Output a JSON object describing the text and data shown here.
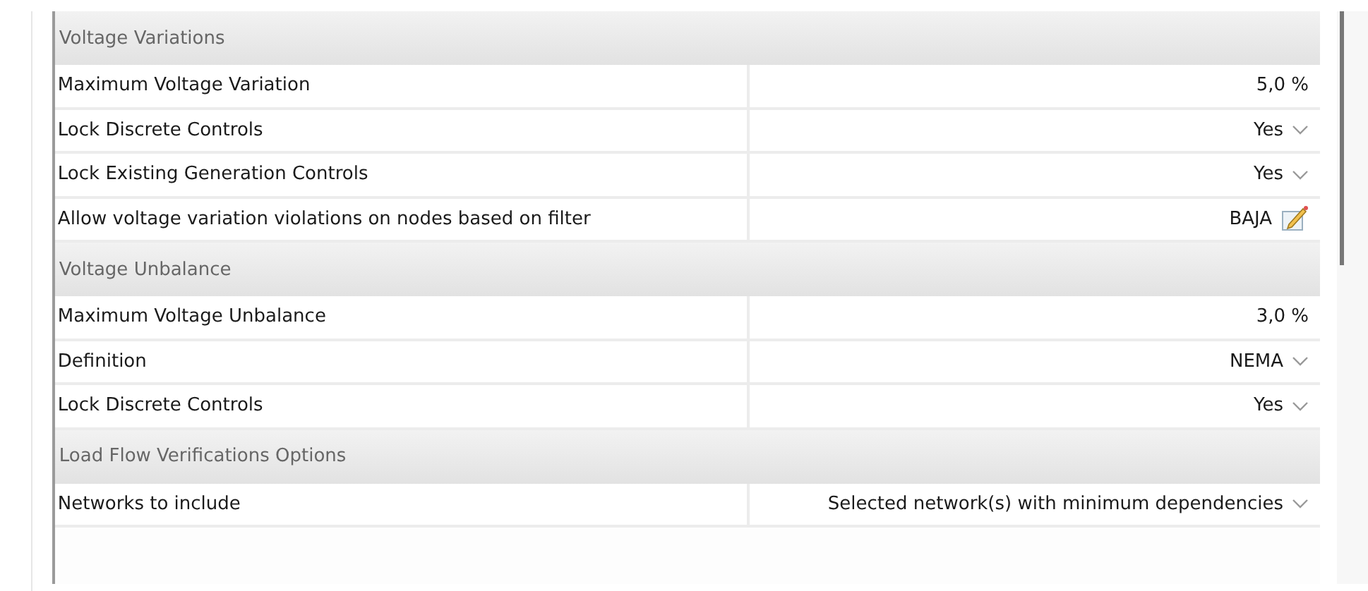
{
  "sections": [
    {
      "title": "Voltage Variations",
      "properties": [
        {
          "name": "Maximum Voltage Variation",
          "value": "5,0 %",
          "kind": "text"
        },
        {
          "name": "Lock Discrete Controls",
          "value": "Yes",
          "kind": "dropdown"
        },
        {
          "name": "Lock Existing Generation Controls",
          "value": "Yes",
          "kind": "dropdown"
        },
        {
          "name": "Allow voltage variation violations on nodes based on filter",
          "value": "BAJA",
          "kind": "filter"
        }
      ]
    },
    {
      "title": "Voltage Unbalance",
      "properties": [
        {
          "name": "Maximum Voltage Unbalance",
          "value": "3,0 %",
          "kind": "text"
        },
        {
          "name": "Definition",
          "value": "NEMA",
          "kind": "dropdown"
        },
        {
          "name": "Lock Discrete Controls",
          "value": "Yes",
          "kind": "dropdown"
        }
      ]
    },
    {
      "title": "Load Flow Verifications Options",
      "properties": [
        {
          "name": "Networks to include",
          "value": "Selected network(s) with minimum dependencies",
          "kind": "dropdown"
        }
      ]
    }
  ]
}
